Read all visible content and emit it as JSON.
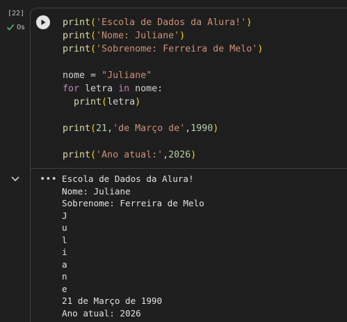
{
  "cell": {
    "execution_count": "[22]",
    "status_label": "0s",
    "status_icon": "check-icon"
  },
  "code": {
    "lines": [
      [
        {
          "t": "print",
          "c": "fn"
        },
        {
          "t": "(",
          "c": "paren"
        },
        {
          "t": "'Escola de Dados da Alura!'",
          "c": "str"
        },
        {
          "t": ")",
          "c": "paren"
        }
      ],
      [
        {
          "t": "print",
          "c": "fn"
        },
        {
          "t": "(",
          "c": "paren"
        },
        {
          "t": "'Nome: Juliane'",
          "c": "str"
        },
        {
          "t": ")",
          "c": "paren"
        }
      ],
      [
        {
          "t": "print",
          "c": "fn"
        },
        {
          "t": "(",
          "c": "paren"
        },
        {
          "t": "'Sobrenome: Ferreira de Melo'",
          "c": "str"
        },
        {
          "t": ")",
          "c": "paren"
        }
      ],
      [],
      [
        {
          "t": "nome",
          "c": "plain"
        },
        {
          "t": " = ",
          "c": "plain"
        },
        {
          "t": "\"Juliane\"",
          "c": "str"
        }
      ],
      [
        {
          "t": "for",
          "c": "kw"
        },
        {
          "t": " letra ",
          "c": "plain"
        },
        {
          "t": "in",
          "c": "kw"
        },
        {
          "t": " nome:",
          "c": "plain"
        }
      ],
      [
        {
          "t": "  ",
          "c": "plain"
        },
        {
          "t": "print",
          "c": "fn"
        },
        {
          "t": "(",
          "c": "paren"
        },
        {
          "t": "letra",
          "c": "plain"
        },
        {
          "t": ")",
          "c": "paren"
        }
      ],
      [],
      [
        {
          "t": "print",
          "c": "fn"
        },
        {
          "t": "(",
          "c": "paren"
        },
        {
          "t": "21",
          "c": "num"
        },
        {
          "t": ",",
          "c": "plain"
        },
        {
          "t": "'de Março de'",
          "c": "str"
        },
        {
          "t": ",",
          "c": "plain"
        },
        {
          "t": "1990",
          "c": "num"
        },
        {
          "t": ")",
          "c": "paren"
        }
      ],
      [],
      [
        {
          "t": "print",
          "c": "fn"
        },
        {
          "t": "(",
          "c": "paren"
        },
        {
          "t": "'Ano atual:'",
          "c": "str"
        },
        {
          "t": ",",
          "c": "plain"
        },
        {
          "t": "2026",
          "c": "num"
        },
        {
          "t": ")",
          "c": "paren"
        }
      ]
    ]
  },
  "output": {
    "lines": [
      "Escola de Dados da Alura!",
      "Nome: Juliane",
      "Sobrenome: Ferreira de Melo",
      "J",
      "u",
      "l",
      "i",
      "a",
      "n",
      "e",
      "21 de Março de 1990",
      "Ano atual: 2026"
    ]
  },
  "toolbar": {
    "more_label": "•••"
  },
  "colors": {
    "background": "#1f1f1f",
    "check": "#5bb974",
    "function": "#dcdcaa",
    "string": "#ce9178",
    "number": "#b5cea8",
    "keyword": "#c586c0"
  }
}
